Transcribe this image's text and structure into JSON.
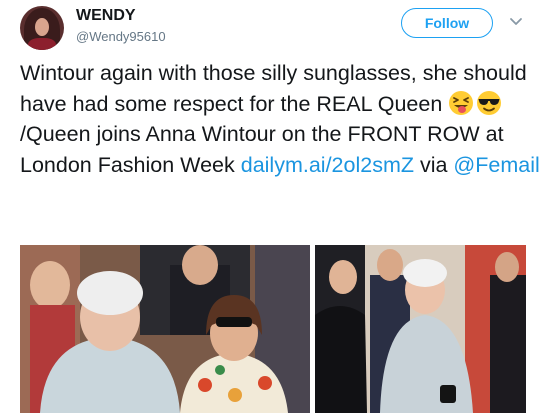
{
  "user": {
    "display_name": "WENDY",
    "handle": "@Wendy95610"
  },
  "actions": {
    "follow_label": "Follow",
    "menu_icon": "chevron-down-icon"
  },
  "tweet": {
    "text_part1": "Wintour again with those silly sunglasses, she should have had some respect for the REAL Queen ",
    "emojis": [
      "squinting-face-with-tongue-emoji",
      "smiling-face-with-sunglasses-emoji"
    ],
    "text_part2": " /Queen joins Anna Wintour on the FRONT ROW at London Fashion Week ",
    "link": "dailym.ai/2ol2smZ",
    "text_part3": " via ",
    "mention": "@Femail"
  },
  "media": [
    {
      "name": "media-photo-front-row"
    },
    {
      "name": "media-photo-queen-arrival"
    }
  ],
  "colors": {
    "accent": "#1da1f2",
    "link": "#1b95e0",
    "text": "#14171a",
    "muted": "#657786"
  }
}
